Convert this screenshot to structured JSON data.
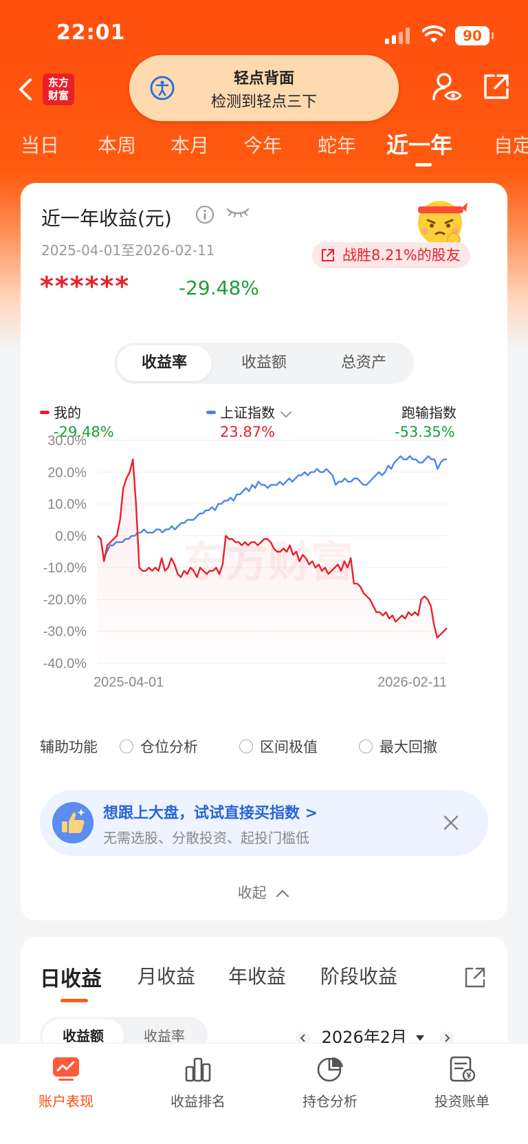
{
  "status_bar": {
    "time": "22:01",
    "battery": "90"
  },
  "header": {
    "logo_text_top": "东方",
    "logo_text_bottom": "财富",
    "toast_title": "轻点背面",
    "toast_subtitle": "检测到轻点三下"
  },
  "tabs": [
    {
      "label": "当日"
    },
    {
      "label": "本周"
    },
    {
      "label": "本月"
    },
    {
      "label": "今年"
    },
    {
      "label": "蛇年"
    },
    {
      "label": "近一年"
    },
    {
      "label": "自定"
    }
  ],
  "summary": {
    "title": "近一年收益(元)",
    "date_range": "2025-04-01至2026-02-11",
    "beat_text": "战胜8.21%的股友",
    "hidden_amount": "******",
    "return_pct": "-29.48%"
  },
  "segment": {
    "options": [
      "收益率",
      "收益额",
      "总资产"
    ],
    "selected": "收益率"
  },
  "legend": {
    "mine_label": "我的",
    "mine_value": "-29.48%",
    "index_label": "上证指数",
    "index_value": "23.87%",
    "lag_label": "跑输指数",
    "lag_value": "-53.35%"
  },
  "colors": {
    "accent": "#ff5a10",
    "up": "#e8202a",
    "down": "#1aa035",
    "index_line": "#4a86e8"
  },
  "chart_data": {
    "type": "line",
    "y_ticks": [
      "30.0%",
      "20.0%",
      "10.0%",
      "0.0%",
      "-10.0%",
      "-20.0%",
      "-30.0%",
      "-40.0%"
    ],
    "ylim": [
      -40,
      30
    ],
    "x_start_label": "2025-04-01",
    "x_end_label": "2026-02-11",
    "watermark": "东方财富",
    "series": [
      {
        "name": "我的",
        "color": "#e8202a",
        "values": [
          0,
          -1,
          -8,
          -3,
          -2,
          -1,
          0,
          5,
          15,
          18,
          20,
          24,
          10,
          -10,
          -11,
          -11,
          -10,
          -11,
          -10,
          -11,
          -7,
          -11,
          -10,
          -7,
          -9,
          -12,
          -13,
          -11,
          -12,
          -10,
          -11,
          -13,
          -10,
          -11,
          -12,
          -11,
          -11,
          -10,
          -12,
          -9,
          0,
          -1,
          -1,
          -2,
          -2,
          -3,
          -2,
          -3,
          -2,
          -2,
          -3,
          -2,
          -1,
          -1,
          -2,
          -4,
          -5,
          -5,
          -4,
          -5,
          -3,
          -6,
          -5,
          -8,
          -6,
          -7,
          -9,
          -8,
          -10,
          -9,
          -11,
          -10,
          -12,
          -11,
          -10,
          -9,
          -11,
          -8,
          -10,
          -7,
          -15,
          -15,
          -16,
          -18,
          -19,
          -20,
          -22,
          -24,
          -24,
          -25,
          -24,
          -26,
          -25,
          -27,
          -26,
          -25,
          -26,
          -24,
          -25,
          -24,
          -25,
          -20,
          -19,
          -20,
          -22,
          -28,
          -32,
          -31,
          -30,
          -29
        ]
      },
      {
        "name": "上证指数",
        "color": "#4a86e8",
        "values": [
          0,
          -1,
          -7,
          -5,
          -3,
          -3,
          -2,
          -2,
          -2,
          -1,
          -1,
          0,
          0,
          1,
          1,
          2,
          1,
          1,
          1,
          2,
          2,
          1,
          2,
          2,
          3,
          2,
          3,
          4,
          4,
          5,
          5,
          5,
          6,
          7,
          7,
          8,
          8,
          9,
          8,
          10,
          10,
          11,
          11,
          12,
          11,
          13,
          13,
          14,
          15,
          14,
          16,
          15,
          17,
          16,
          16,
          15,
          16,
          16,
          16,
          17,
          16,
          17,
          18,
          17,
          18,
          19,
          19,
          20,
          19,
          20,
          20,
          21,
          20,
          20,
          21,
          20,
          19,
          16,
          17,
          17,
          18,
          17,
          17,
          18,
          18,
          17,
          16,
          16,
          17,
          18,
          19,
          20,
          19,
          20,
          22,
          21,
          23,
          24,
          25,
          24,
          24,
          25,
          24,
          24,
          23,
          23,
          24,
          25,
          24,
          24,
          21,
          23,
          24,
          24
        ]
      }
    ]
  },
  "aux": {
    "label": "辅助功能",
    "options": [
      "仓位分析",
      "区间极值",
      "最大回撤"
    ]
  },
  "promo": {
    "title": "想跟上大盘，试试直接买指数 >",
    "subtitle": "无需选股、分散投资、起投门槛低"
  },
  "collapse_label": "收起",
  "earnings_tabs": [
    "日收益",
    "月收益",
    "年收益",
    "阶段收益"
  ],
  "earnings_segment": [
    "收益额",
    "收益率"
  ],
  "month": "2026年2月",
  "bottom_nav": [
    "账户表现",
    "收益排名",
    "持仓分析",
    "投资账单"
  ]
}
